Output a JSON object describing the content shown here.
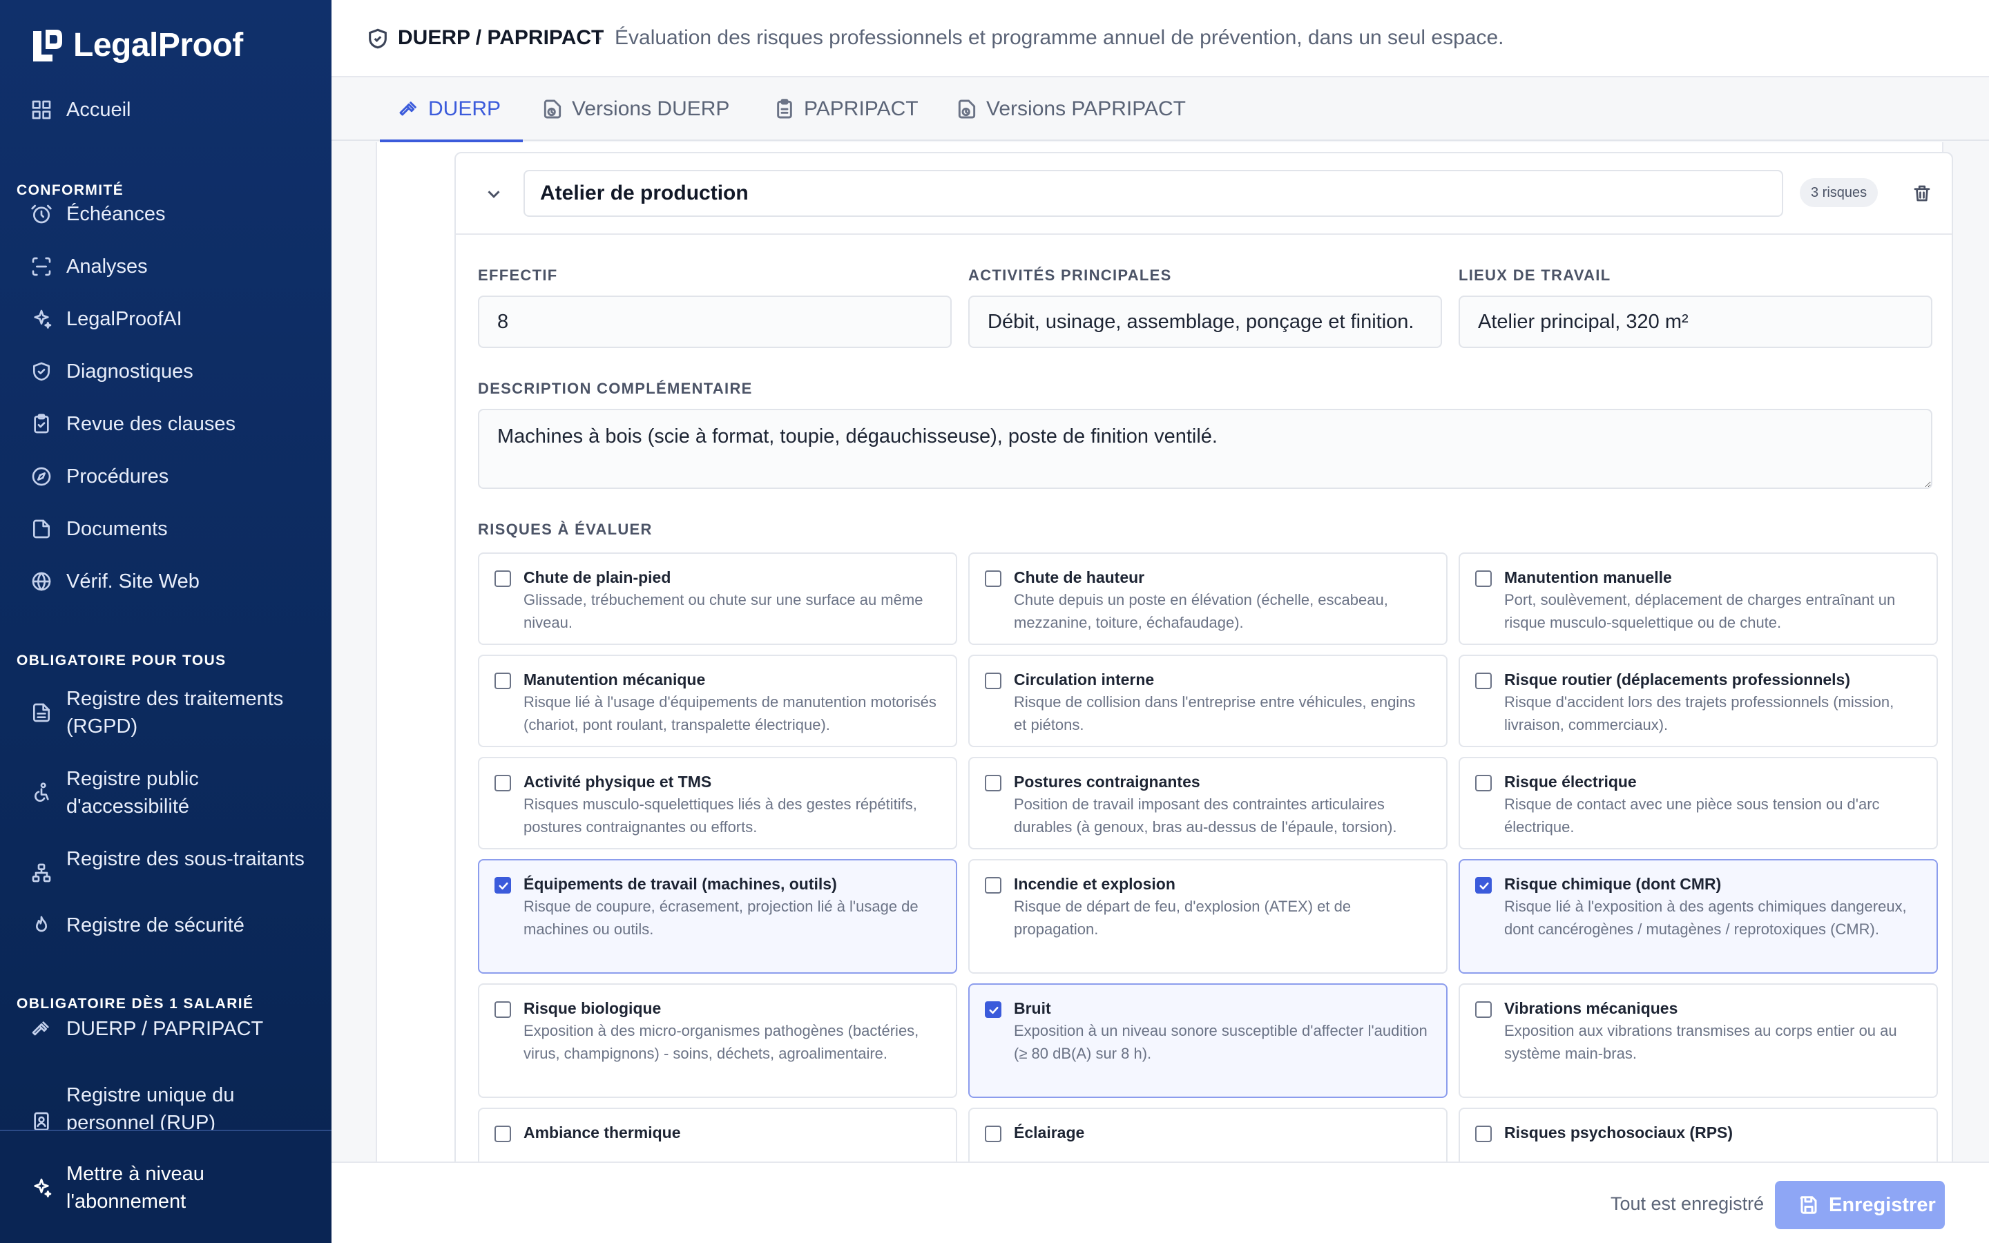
{
  "brand": {
    "name": "LegalProof"
  },
  "sidebar": {
    "home": {
      "label": "Accueil",
      "icon": "dashboard-icon"
    },
    "sections": [
      {
        "title": "CONFORMITÉ"
      },
      {
        "title": "OBLIGATOIRE POUR TOUS"
      },
      {
        "title": "OBLIGATOIRE DÈS 1 SALARIÉ"
      }
    ],
    "items": [
      {
        "label": "Échéances",
        "icon": "alarm-clock-icon"
      },
      {
        "label": "Analyses",
        "icon": "scan-icon"
      },
      {
        "label": "LegalProofAI",
        "icon": "sparkles-icon"
      },
      {
        "label": "Diagnostiques",
        "icon": "shield-check-icon"
      },
      {
        "label": "Revue des clauses",
        "icon": "clipboard-check-icon"
      },
      {
        "label": "Procédures",
        "icon": "compass-icon"
      },
      {
        "label": "Documents",
        "icon": "file-icon"
      },
      {
        "label": "Vérif. Site Web",
        "icon": "globe-icon"
      },
      {
        "label": "Registre des traitements (RGPD)",
        "icon": "file-list-icon"
      },
      {
        "label": "Registre public d'accessibilité",
        "icon": "accessibility-icon"
      },
      {
        "label": "Registre des sous-traitants",
        "icon": "network-icon"
      },
      {
        "label": "Registre de sécurité",
        "icon": "flame-icon"
      },
      {
        "label": "DUERP / PAPRIPACT",
        "icon": "hammer-icon"
      },
      {
        "label": "Registre unique du personnel (RUP)",
        "icon": "id-badge-icon"
      }
    ],
    "upgrade": {
      "label": "Mettre à niveau l'abonnement",
      "icon": "sparkles-icon"
    }
  },
  "header": {
    "title": "DUERP / PAPRIPACT",
    "separator": "·",
    "subtitle": "Évaluation des risques professionnels et programme annuel de prévention, dans un seul espace."
  },
  "tabs": [
    {
      "label": "DUERP",
      "active": true,
      "icon": "hammer-icon"
    },
    {
      "label": "Versions DUERP",
      "active": false,
      "icon": "file-clock-icon"
    },
    {
      "label": "PAPRIPACT",
      "active": false,
      "icon": "clipboard-icon"
    },
    {
      "label": "Versions PAPRIPACT",
      "active": false,
      "icon": "file-clock-icon"
    }
  ],
  "unit": {
    "name": "Atelier de production",
    "risk_count": "3 risques",
    "fields": {
      "effectif": {
        "label": "EFFECTIF",
        "value": "8"
      },
      "activites": {
        "label": "ACTIVITÉS PRINCIPALES",
        "value": "Débit, usinage, assemblage, ponçage et finition."
      },
      "lieux": {
        "label": "LIEUX DE TRAVAIL",
        "value": "Atelier principal, 320 m²"
      },
      "description": {
        "label": "DESCRIPTION COMPLÉMENTAIRE",
        "value": "Machines à bois (scie à format, toupie, dégauchisseuse), poste de finition ventilé."
      }
    },
    "risks_label": "RISQUES À ÉVALUER",
    "risks": [
      {
        "title": "Chute de plain-pied",
        "desc": "Glissade, trébuchement ou chute sur une surface au même niveau.",
        "checked": false
      },
      {
        "title": "Chute de hauteur",
        "desc": "Chute depuis un poste en élévation (échelle, escabeau, mezzanine, toiture, échafaudage).",
        "checked": false
      },
      {
        "title": "Manutention manuelle",
        "desc": "Port, soulèvement, déplacement de charges entraînant un risque musculo-squelettique ou de chute.",
        "checked": false
      },
      {
        "title": "Manutention mécanique",
        "desc": "Risque lié à l'usage d'équipements de manutention motorisés (chariot, pont roulant, transpalette électrique).",
        "checked": false
      },
      {
        "title": "Circulation interne",
        "desc": "Risque de collision dans l'entreprise entre véhicules, engins et piétons.",
        "checked": false
      },
      {
        "title": "Risque routier (déplacements professionnels)",
        "desc": "Risque d'accident lors des trajets professionnels (mission, livraison, commerciaux).",
        "checked": false
      },
      {
        "title": "Activité physique et TMS",
        "desc": "Risques musculo-squelettiques liés à des gestes répétitifs, postures contraignantes ou efforts.",
        "checked": false
      },
      {
        "title": "Postures contraignantes",
        "desc": "Position de travail imposant des contraintes articulaires durables (à genoux, bras au-dessus de l'épaule, torsion).",
        "checked": false
      },
      {
        "title": "Risque électrique",
        "desc": "Risque de contact avec une pièce sous tension ou d'arc électrique.",
        "checked": false
      },
      {
        "title": "Équipements de travail (machines, outils)",
        "desc": "Risque de coupure, écrasement, projection lié à l'usage de machines ou outils.",
        "checked": true
      },
      {
        "title": "Incendie et explosion",
        "desc": "Risque de départ de feu, d'explosion (ATEX) et de propagation.",
        "checked": false
      },
      {
        "title": "Risque chimique (dont CMR)",
        "desc": "Risque lié à l'exposition à des agents chimiques dangereux, dont cancérogènes / mutagènes / reprotoxiques (CMR).",
        "checked": true
      },
      {
        "title": "Risque biologique",
        "desc": "Exposition à des micro-organismes pathogènes (bactéries, virus, champignons) - soins, déchets, agroalimentaire.",
        "checked": false
      },
      {
        "title": "Bruit",
        "desc": "Exposition à un niveau sonore susceptible d'affecter l'audition (≥ 80 dB(A) sur 8 h).",
        "checked": true
      },
      {
        "title": "Vibrations mécaniques",
        "desc": "Exposition aux vibrations transmises au corps entier ou au système main-bras.",
        "checked": false
      },
      {
        "title": "Ambiance thermique",
        "desc": "",
        "checked": false
      },
      {
        "title": "Éclairage",
        "desc": "",
        "checked": false
      },
      {
        "title": "Risques psychosociaux (RPS)",
        "desc": "",
        "checked": false
      }
    ]
  },
  "footer": {
    "status": "Tout est enregistré",
    "save_label": "Enregistrer"
  },
  "colors": {
    "sidebar": "#0c2a5e",
    "accent": "#3b5bdb",
    "save_button": "#8ea6f5"
  }
}
